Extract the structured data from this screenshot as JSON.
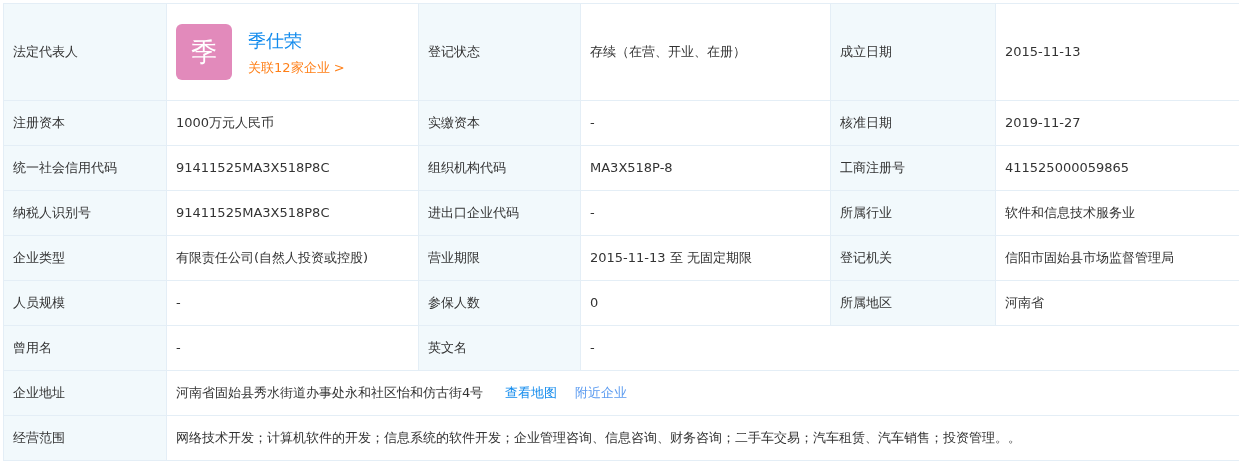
{
  "rows": [
    {
      "cells": [
        {
          "kind": "label",
          "text": "法定代表人"
        },
        {
          "kind": "person",
          "avatar_char": "季",
          "name": "季仕荣",
          "link": "关联12家企业 >"
        },
        {
          "kind": "label",
          "text": "登记状态"
        },
        {
          "kind": "value",
          "text": "存续（在营、开业、在册）"
        },
        {
          "kind": "label",
          "text": "成立日期"
        },
        {
          "kind": "value",
          "text": "2015-11-13"
        }
      ]
    },
    {
      "cells": [
        {
          "kind": "label",
          "text": "注册资本"
        },
        {
          "kind": "value",
          "text": "1000万元人民币"
        },
        {
          "kind": "label",
          "text": "实缴资本"
        },
        {
          "kind": "value",
          "text": "-"
        },
        {
          "kind": "label",
          "text": "核准日期"
        },
        {
          "kind": "value",
          "text": "2019-11-27"
        }
      ]
    },
    {
      "cells": [
        {
          "kind": "label",
          "text": "统一社会信用代码"
        },
        {
          "kind": "value",
          "text": "91411525MA3X518P8C"
        },
        {
          "kind": "label",
          "text": "组织机构代码"
        },
        {
          "kind": "value",
          "text": "MA3X518P-8"
        },
        {
          "kind": "label",
          "text": "工商注册号"
        },
        {
          "kind": "value",
          "text": "411525000059865"
        }
      ]
    },
    {
      "cells": [
        {
          "kind": "label",
          "text": "纳税人识别号"
        },
        {
          "kind": "value",
          "text": "91411525MA3X518P8C"
        },
        {
          "kind": "label",
          "text": "进出口企业代码"
        },
        {
          "kind": "value",
          "text": "-"
        },
        {
          "kind": "label",
          "text": "所属行业"
        },
        {
          "kind": "value",
          "text": "软件和信息技术服务业"
        }
      ]
    },
    {
      "cells": [
        {
          "kind": "label",
          "text": "企业类型"
        },
        {
          "kind": "value",
          "text": "有限责任公司(自然人投资或控股)"
        },
        {
          "kind": "label",
          "text": "营业期限"
        },
        {
          "kind": "value",
          "text": "2015-11-13 至 无固定期限"
        },
        {
          "kind": "label",
          "text": "登记机关"
        },
        {
          "kind": "value",
          "text": "信阳市固始县市场监督管理局"
        }
      ]
    },
    {
      "cells": [
        {
          "kind": "label",
          "text": "人员规模"
        },
        {
          "kind": "value",
          "text": "-"
        },
        {
          "kind": "label",
          "text": "参保人数"
        },
        {
          "kind": "value",
          "text": "0"
        },
        {
          "kind": "label",
          "text": "所属地区"
        },
        {
          "kind": "value",
          "text": "河南省"
        }
      ]
    },
    {
      "cells": [
        {
          "kind": "label",
          "text": "曾用名"
        },
        {
          "kind": "value",
          "text": "-"
        },
        {
          "kind": "label",
          "text": "英文名"
        },
        {
          "kind": "value",
          "text": "-"
        }
      ]
    },
    {
      "cells": [
        {
          "kind": "label",
          "text": "企业地址"
        },
        {
          "kind": "value",
          "text": "河南省固始县秀水街道办事处永和社区怡和仿古街4号",
          "links": [
            "查看地图",
            "附近企业"
          ]
        }
      ]
    },
    {
      "cells": [
        {
          "kind": "label",
          "text": "经营范围"
        },
        {
          "kind": "value",
          "text": "网络技术开发；计算机软件的开发；信息系统的软件开发；企业管理咨询、信息咨询、财务咨询；二手车交易；汽车租赁、汽车销售；投资管理。。"
        }
      ]
    }
  ]
}
